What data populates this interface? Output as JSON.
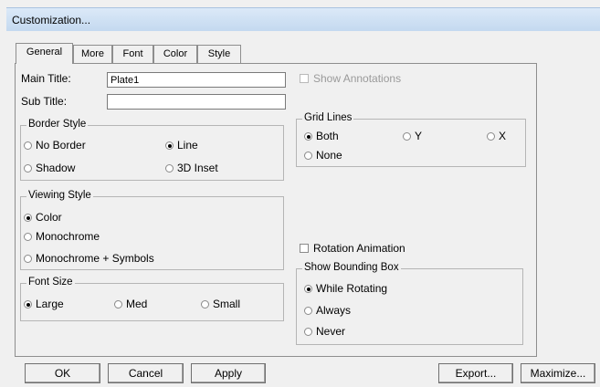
{
  "window": {
    "title": "Customization..."
  },
  "tabs": [
    {
      "label": "General",
      "active": true
    },
    {
      "label": "More"
    },
    {
      "label": "Font"
    },
    {
      "label": "Color"
    },
    {
      "label": "Style"
    }
  ],
  "general": {
    "main_title": {
      "label": "Main Title:",
      "value": "Plate1"
    },
    "sub_title": {
      "label": "Sub Title:",
      "value": ""
    },
    "show_annotations": {
      "label": "Show Annotations",
      "checked": false,
      "enabled": false
    },
    "border_style": {
      "title": "Border Style",
      "options": [
        "No Border",
        "Line",
        "Shadow",
        "3D Inset"
      ],
      "selected": "Line"
    },
    "grid_lines": {
      "title": "Grid Lines",
      "options": [
        "Both",
        "Y",
        "X",
        "None"
      ],
      "selected": "Both"
    },
    "viewing_style": {
      "title": "Viewing Style",
      "options": [
        "Color",
        "Monochrome",
        "Monochrome + Symbols"
      ],
      "selected": "Color"
    },
    "rotation_animation": {
      "label": "Rotation Animation",
      "checked": false
    },
    "show_bounding_box": {
      "title": "Show Bounding Box",
      "options": [
        "While Rotating",
        "Always",
        "Never"
      ],
      "selected": "While Rotating"
    },
    "font_size": {
      "title": "Font Size",
      "options": [
        "Large",
        "Med",
        "Small"
      ],
      "selected": "Large"
    }
  },
  "buttons": {
    "ok": "OK",
    "cancel": "Cancel",
    "apply": "Apply",
    "export": "Export...",
    "maximize": "Maximize..."
  }
}
